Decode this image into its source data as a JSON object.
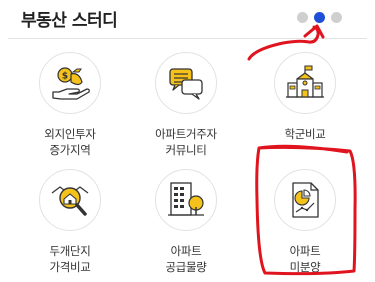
{
  "header": {
    "title": "부동산 스터디",
    "pagination": {
      "total": 3,
      "active_index": 1
    }
  },
  "colors": {
    "accent_blue": "#1e4fd8",
    "icon_yellow": "#f4c21a",
    "icon_dark": "#333333",
    "annotation_red": "#e0141e"
  },
  "menu": {
    "items": [
      {
        "icon": "money-bag-hand-icon",
        "line1": "외지인투자",
        "line2": "증가지역"
      },
      {
        "icon": "chat-bubbles-icon",
        "line1": "아파트거주자",
        "line2": "커뮤니티"
      },
      {
        "icon": "school-building-icon",
        "line1": "학군비교",
        "line2": ""
      },
      {
        "icon": "magnifier-house-icon",
        "line1": "두개단지",
        "line2": "가격비교"
      },
      {
        "icon": "apartment-tree-icon",
        "line1": "아파트",
        "line2": "공급물량"
      },
      {
        "icon": "report-chart-icon",
        "line1": "아파트",
        "line2": "미분양"
      }
    ]
  }
}
